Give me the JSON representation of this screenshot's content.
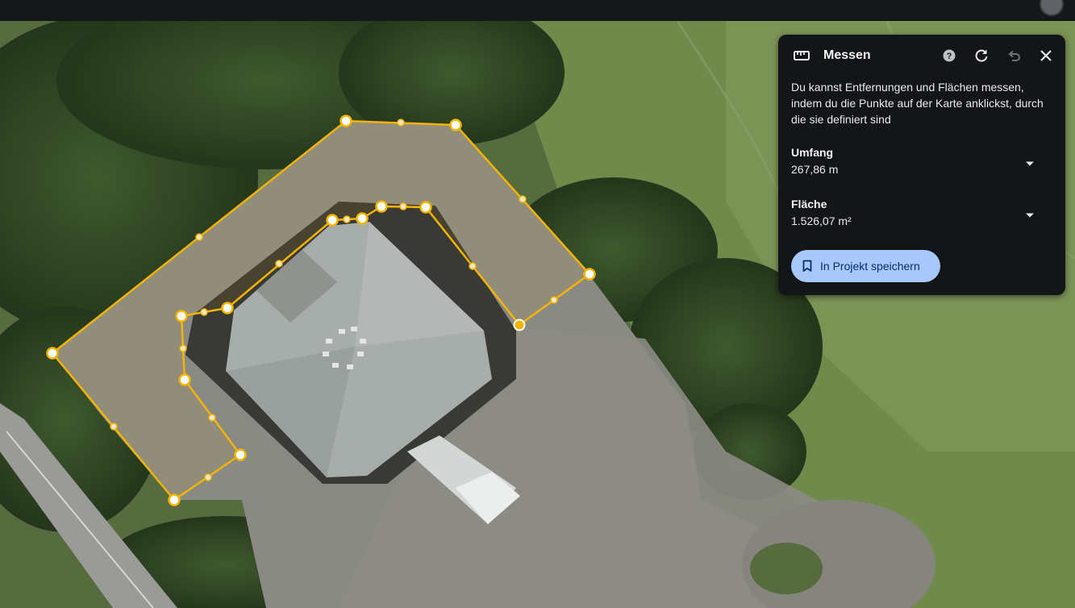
{
  "panel": {
    "title": "Messen",
    "description": "Du kannst Entfernungen und Flächen messen, indem du die Punkte auf der Karte anklickst, durch die sie definiert sind",
    "perimeter_label": "Umfang",
    "perimeter_value": "267,86 m",
    "area_label": "Fläche",
    "area_value": "1.526,07 m²",
    "save_button": "In Projekt speichern",
    "icons": [
      "ruler-icon",
      "help-icon",
      "refresh-icon",
      "undo-icon",
      "close-icon",
      "dropdown-arrow-icon",
      "bookmark-icon"
    ]
  },
  "map": {
    "type": "satellite",
    "measurement_color": "#f4b400"
  },
  "colors": {
    "panel_bg": "#141517",
    "button_bg": "#a8c7fa",
    "button_text": "#062e6f",
    "line": "#f4b400"
  }
}
